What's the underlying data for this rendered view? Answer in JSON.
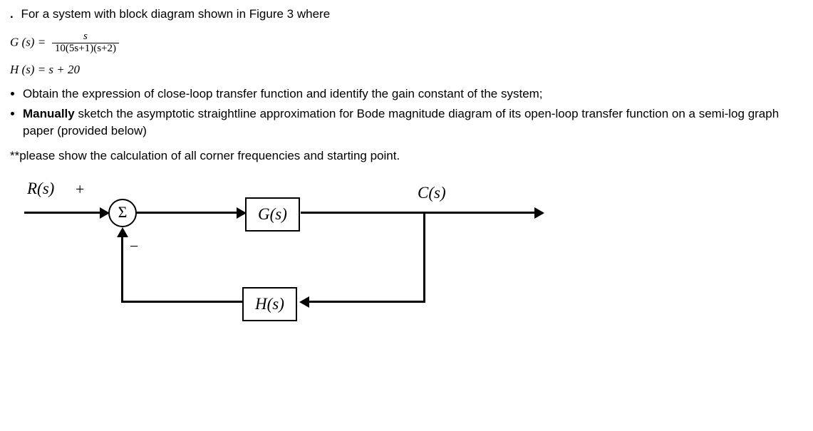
{
  "intro": {
    "bullet": ".",
    "text": "For a system with block diagram shown in Figure 3 where"
  },
  "equations": {
    "g_lhs": "G (s) =",
    "g_frac_num": "s",
    "g_frac_den": "10(5s+1)(s+2)",
    "h": "H (s) = s + 20"
  },
  "bullets": [
    "Obtain the expression of close-loop transfer function and identify the gain constant of the system;",
    {
      "prefix_bold": "Manually",
      "rest": " sketch the asymptotic straightline approximation for Bode magnitude diagram of its open-loop transfer function on a semi-log graph paper (provided below)"
    }
  ],
  "note": "**please show the calculation of all corner frequencies and starting point.",
  "diagram": {
    "r_label": "R(s)",
    "plus": "+",
    "minus": "−",
    "sum": "Σ",
    "g_block": "G(s)",
    "h_block": "H(s)",
    "c_label": "C(s)"
  }
}
